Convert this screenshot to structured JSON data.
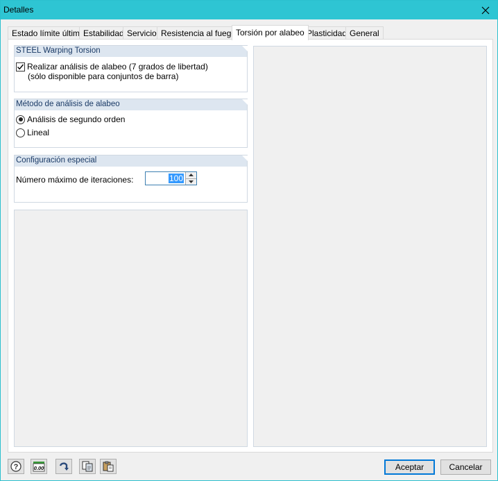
{
  "window": {
    "title": "Detalles"
  },
  "tabs": [
    {
      "label": "Estado límite último"
    },
    {
      "label": "Estabilidad"
    },
    {
      "label": "Servicio"
    },
    {
      "label": "Resistencia al fuego"
    },
    {
      "label": "Torsión por alabeo",
      "active": true
    },
    {
      "label": "Plasticidad"
    },
    {
      "label": "General"
    }
  ],
  "warping": {
    "header": "STEEL Warping Torsion",
    "checkbox_label": "Realizar análisis de alabeo (7 grados de libertad)",
    "checkbox_note": "(sólo disponible para conjuntos de barra)",
    "checked": true
  },
  "method": {
    "header": "Método de análisis de alabeo",
    "options": [
      {
        "label": "Análisis de segundo orden",
        "selected": true
      },
      {
        "label": "Lineal",
        "selected": false
      }
    ]
  },
  "special": {
    "header": "Configuración especial",
    "iterations_label": "Número máximo de iteraciones:",
    "iterations_value": "100"
  },
  "footer": {
    "icons": [
      "help-icon",
      "units-icon",
      "reset-icon",
      "copy-icon",
      "paste-icon"
    ],
    "units_glyph": "0.00",
    "accept_label": "Aceptar",
    "cancel_label": "Cancelar"
  },
  "colors": {
    "titlebar": "#2ec5d3",
    "group_header": "#dde6f0",
    "group_header_text": "#1a3a66",
    "selection": "#3399ff",
    "default_button_border": "#0078d7"
  }
}
